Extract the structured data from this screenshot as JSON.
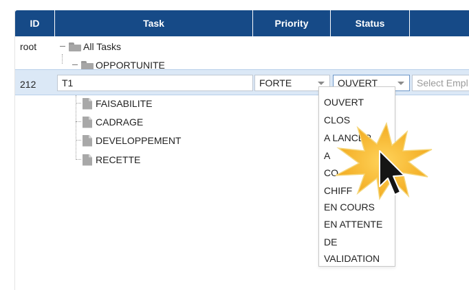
{
  "grid": {
    "columns": [
      "ID",
      "Task",
      "Priority",
      "Status",
      ""
    ],
    "root_row": {
      "id": "root",
      "label": "All Tasks"
    },
    "child_folder": {
      "label": "OPPORTUNITE"
    },
    "edit_row": {
      "id": "212",
      "task_value": "T1",
      "priority_value": "FORTE",
      "status_value": "OUVERT",
      "employee_placeholder": "Select Empl"
    },
    "leaf_items": [
      "FAISABILITE",
      "CADRAGE",
      "DEVELOPPEMENT",
      "RECETTE"
    ]
  },
  "status_dropdown": {
    "options": [
      "OUVERT",
      "CLOS",
      "A LANCER",
      "A",
      "CO",
      "CHIFF",
      "EN COURS",
      "EN ATTENTE",
      "DE",
      "VALIDATION"
    ]
  },
  "colors": {
    "header_bg": "#164a87",
    "selected_row_bg": "#dbe8f6",
    "highlight_burst": "#f5b324"
  },
  "icons": {
    "tree_toggle": "minus-box-icon",
    "folder": "folder-icon",
    "document": "document-icon",
    "combo_arrow": "chevron-down-icon",
    "cursor": "mouse-pointer-icon"
  }
}
